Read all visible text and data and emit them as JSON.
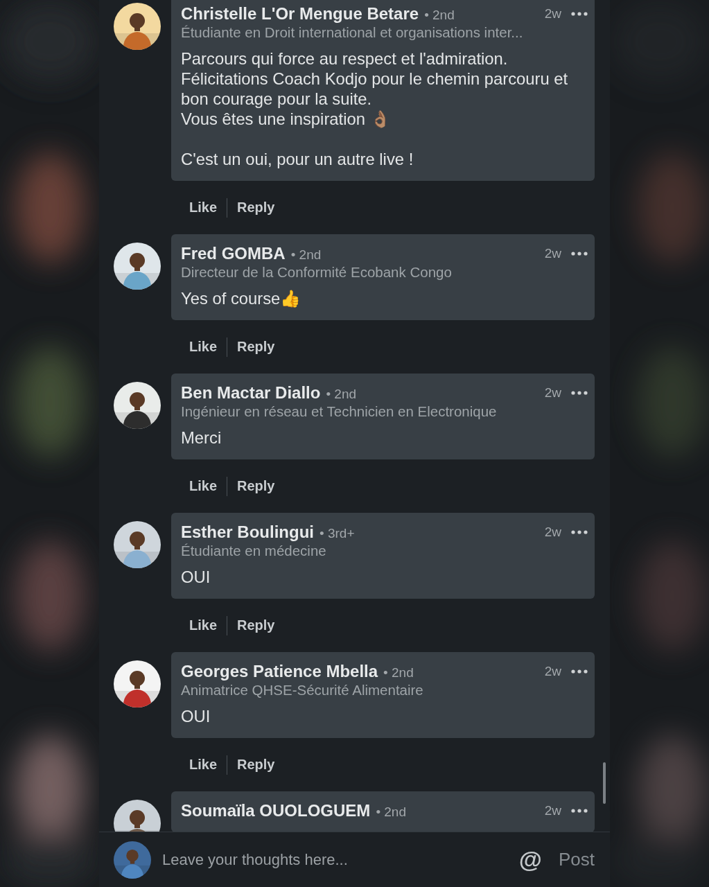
{
  "comments": [
    {
      "name": "Christelle L'Or Mengue Betare",
      "degree": "• 2nd",
      "time": "2w",
      "headline": "Étudiante en Droit international et organisations inter...",
      "body": "Parcours qui force au respect et l'admiration.\nFélicitations Coach Kodjo pour le chemin parcouru et bon courage pour la suite.\nVous êtes une inspiration 👌🏽\n\nC'est un oui, pour un autre live !",
      "actions": [
        "Like",
        "Reply"
      ]
    },
    {
      "name": "Fred GOMBA",
      "degree": "• 2nd",
      "time": "2w",
      "headline": "Directeur de la Conformité Ecobank Congo",
      "body": "Yes of course👍",
      "actions": [
        "Like",
        "Reply"
      ]
    },
    {
      "name": "Ben Mactar Diallo",
      "degree": "• 2nd",
      "time": "2w",
      "headline": "Ingénieur en réseau et Technicien en Electronique",
      "body": "Merci",
      "actions": [
        "Like",
        "Reply"
      ]
    },
    {
      "name": "Esther Boulingui",
      "degree": "• 3rd+",
      "time": "2w",
      "headline": "Étudiante en médecine",
      "body": "OUI",
      "actions": [
        "Like",
        "Reply"
      ]
    },
    {
      "name": "Georges Patience Mbella",
      "degree": "• 2nd",
      "time": "2w",
      "headline": "Animatrice QHSE-Sécurité Alimentaire",
      "body": "OUI",
      "actions": [
        "Like",
        "Reply"
      ]
    },
    {
      "name": "Soumaïla OUOLOGUEM",
      "degree": "• 2nd",
      "time": "2w"
    }
  ],
  "composer": {
    "placeholder": "Leave your thoughts here...",
    "mention": "@",
    "post": "Post"
  }
}
